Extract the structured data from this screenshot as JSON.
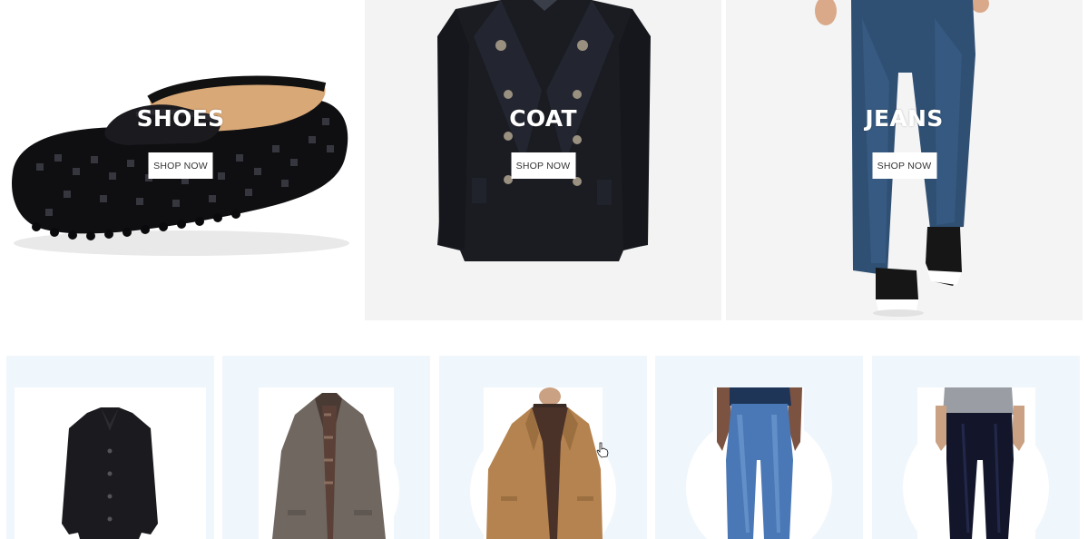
{
  "banners": [
    {
      "title": "SHOES",
      "button": "SHOP NOW",
      "image_icon": "loafer-shoe-icon"
    },
    {
      "title": "COAT",
      "button": "SHOP NOW",
      "image_icon": "peacoat-icon"
    },
    {
      "title": "JEANS",
      "button": "SHOP NOW",
      "image_icon": "jeans-model-icon"
    }
  ],
  "products": [
    {
      "image_icon": "black-wool-coat-icon"
    },
    {
      "image_icon": "grey-tweed-overcoat-icon"
    },
    {
      "image_icon": "tan-car-coat-icon"
    },
    {
      "image_icon": "light-wash-jeans-icon"
    },
    {
      "image_icon": "dark-skinny-jeans-icon"
    }
  ],
  "colors": {
    "card_bg": "#f0f7fc",
    "banner_title": "#ffffff",
    "button_bg": "#ffffff"
  }
}
